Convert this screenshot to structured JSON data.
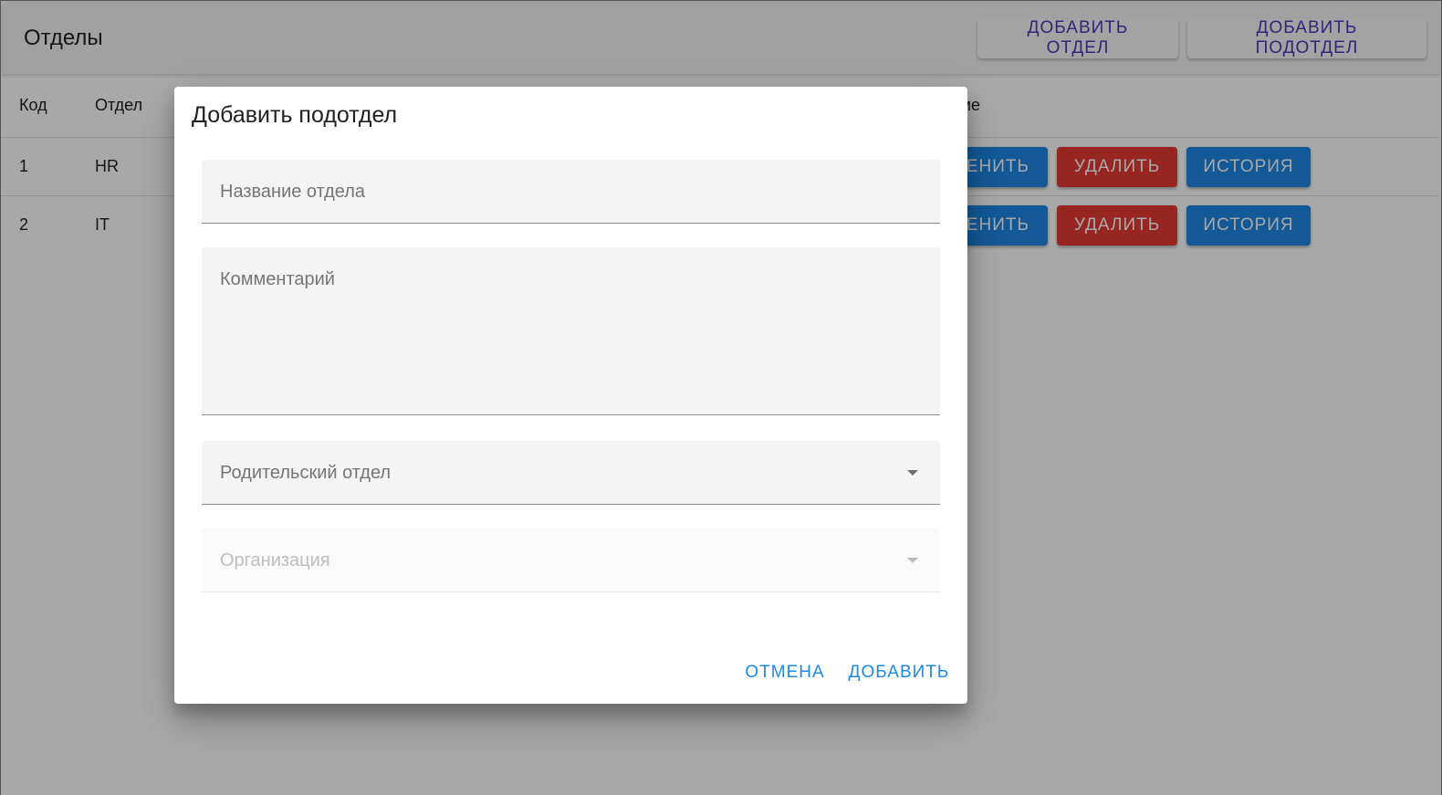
{
  "app": {
    "title": "Отделы",
    "add_department_label": "ДОБАВИТЬ ОТДЕЛ",
    "add_subdepartment_label": "ДОБАВИТЬ ПОДОТДЕЛ"
  },
  "table": {
    "headers": [
      "Код",
      "Отдел",
      "ие"
    ],
    "rows": [
      {
        "code": "1",
        "name": "HR",
        "edit": "ЕНИТЬ",
        "delete": "УДАЛИТЬ",
        "history": "ИСТОРИЯ"
      },
      {
        "code": "2",
        "name": "IT",
        "edit": "ЕНИТЬ",
        "delete": "УДАЛИТЬ",
        "history": "ИСТОРИЯ"
      }
    ]
  },
  "dialog": {
    "title": "Добавить подотдел",
    "name_label": "Название отдела",
    "comment_label": "Комментарий",
    "parent_label": "Родительский отдел",
    "organization_label": "Организация",
    "cancel_label": "ОТМЕНА",
    "add_label": "ДОБАВИТЬ"
  },
  "colors": {
    "primary": "#1e88e5",
    "danger": "#e53935",
    "accent_text": "#4a3ab8"
  },
  "icons": [
    "dropdown-caret-icon"
  ]
}
